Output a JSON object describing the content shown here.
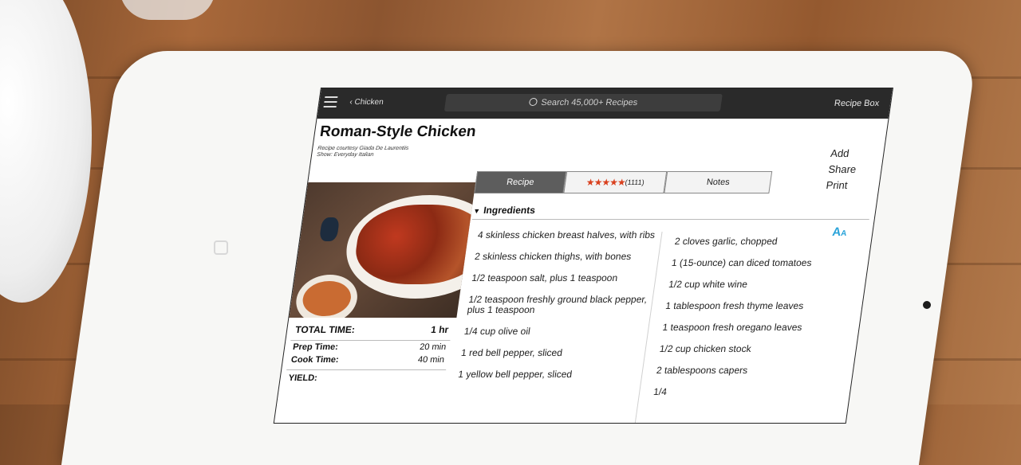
{
  "app": {
    "back_label": "Chicken",
    "search_placeholder": "Search 45,000+ Recipes",
    "recipe_box_label": "Recipe Box"
  },
  "recipe": {
    "title": "Roman-Style Chicken",
    "courtesy_line1": "Recipe courtesy Giada De Laurentiis",
    "courtesy_line2": "Show: Everyday Italian"
  },
  "actions": [
    "Add",
    "Share",
    "Print"
  ],
  "tabs": {
    "recipe": "Recipe",
    "rating_count": "(1111)",
    "notes": "Notes"
  },
  "rating": {
    "stars": 5,
    "max": 5
  },
  "times": {
    "total_label": "TOTAL TIME:",
    "total_value": "1 hr",
    "prep_label": "Prep Time:",
    "prep_value": "20 min",
    "cook_label": "Cook Time:",
    "cook_value": "40 min",
    "yield_label": "YIELD:"
  },
  "ingredients": {
    "heading": "Ingredients",
    "column1": [
      "4 skinless chicken breast halves, with ribs",
      "2 skinless chicken thighs, with bones",
      "1/2 teaspoon salt, plus 1 teaspoon",
      "1/2 teaspoon freshly ground black pepper, plus 1 teaspoon",
      "1/4 cup olive oil",
      "1 red bell pepper, sliced",
      "1 yellow bell pepper, sliced"
    ],
    "column2": [
      "2 cloves garlic, chopped",
      "1 (15-ounce) can diced tomatoes",
      "1/2 cup white wine",
      "1 tablespoon fresh thyme leaves",
      "1 teaspoon fresh oregano leaves",
      "1/2 cup chicken stock",
      "2 tablespoons capers",
      "1/4"
    ]
  },
  "colors": {
    "accent_star": "#d9401e",
    "text_size_icon": "#29a3d9",
    "topbar": "#2a2a2a"
  },
  "icons": [
    "menu-icon",
    "search-icon",
    "chevron-left-icon",
    "chevron-down-icon",
    "text-size-icon",
    "star-icon"
  ]
}
